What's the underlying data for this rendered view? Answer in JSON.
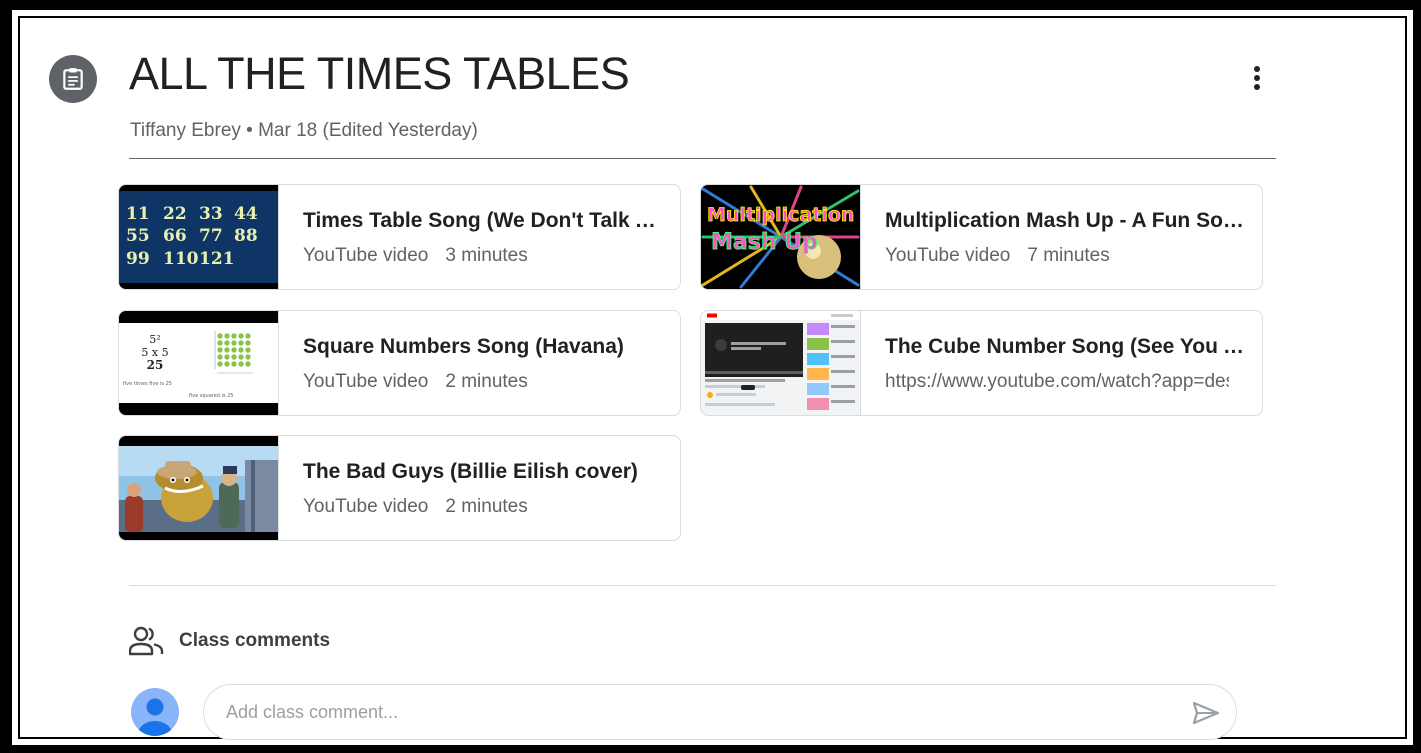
{
  "post": {
    "title": "ALL THE TIMES TABLES",
    "author": "Tiffany Ebrey",
    "separator": "•",
    "date": "Mar 18 (Edited Yesterday)",
    "icon": "assignment-icon",
    "more_icon": "more-vert-icon"
  },
  "attachments": [
    {
      "title": "Times Table Song (We Don't Talk About Bruno)",
      "type": "YouTube video",
      "duration": "3 minutes",
      "thumb_text": [
        "11",
        "22",
        "33",
        "44",
        "55",
        "66",
        "77",
        "88",
        "99",
        "110",
        "121"
      ]
    },
    {
      "title": "Multiplication Mash Up - A Fun Song",
      "type": "YouTube video",
      "duration": "7 minutes",
      "thumb_text": [
        "Multiplication",
        "Mash Up"
      ]
    },
    {
      "title": "Square Numbers Song (Havana)",
      "type": "YouTube video",
      "duration": "2 minutes",
      "thumb_text": [
        "5²",
        "5 x 5",
        "25",
        "five times five is 25",
        "five squared is 25"
      ]
    },
    {
      "title": "The Cube Number Song (See You Again)",
      "subtitle": "https://www.youtube.com/watch?app=desktop"
    },
    {
      "title": "The Bad Guys (Billie Eilish cover)",
      "type": "YouTube video",
      "duration": "2 minutes"
    }
  ],
  "comments": {
    "label": "Class comments",
    "placeholder": "Add class comment...",
    "people_icon": "people-icon",
    "send_icon": "send-icon"
  },
  "colors": {
    "title_text": "#202124",
    "secondary_text": "#5f6368",
    "border": "#dadce0",
    "avatar": "#8ab4f8",
    "avatar_figure": "#1a73e8"
  }
}
